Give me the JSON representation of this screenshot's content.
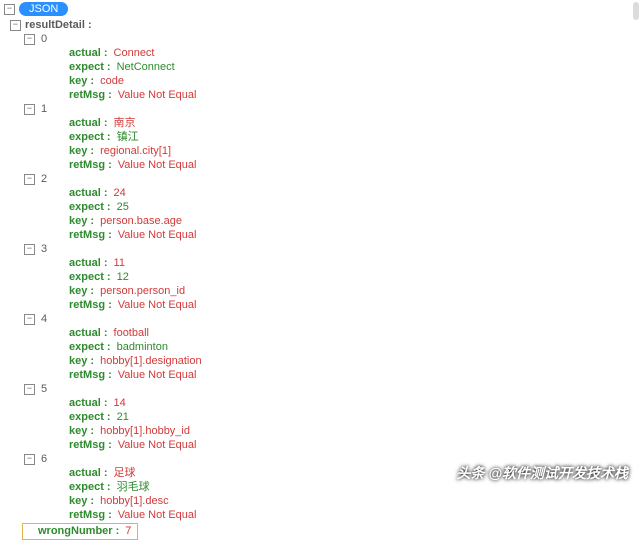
{
  "root": {
    "badge": "JSON"
  },
  "topKey": "resultDetail :",
  "toggle": {
    "plus": "+",
    "minus": "−"
  },
  "labels": {
    "actual": "actual :",
    "expect": "expect :",
    "key": "key :",
    "retMsg": "retMsg :"
  },
  "items": [
    {
      "idx": "0",
      "actual": "Connect",
      "expect": "NetConnect",
      "key": "code",
      "retMsg": "Value Not Equal"
    },
    {
      "idx": "1",
      "actual": "南京",
      "expect": "镇江",
      "key": "regional.city[1]",
      "retMsg": "Value Not Equal"
    },
    {
      "idx": "2",
      "actual": "24",
      "expect": "25",
      "key": "person.base.age",
      "retMsg": "Value Not Equal"
    },
    {
      "idx": "3",
      "actual": "11",
      "expect": "12",
      "key": "person.person_id",
      "retMsg": "Value Not Equal"
    },
    {
      "idx": "4",
      "actual": "football",
      "expect": "badminton",
      "key": "hobby[1].designation",
      "retMsg": "Value Not Equal"
    },
    {
      "idx": "5",
      "actual": "14",
      "expect": "21",
      "key": "hobby[1].hobby_id",
      "retMsg": "Value Not Equal"
    },
    {
      "idx": "6",
      "actual": "足球",
      "expect": "羽毛球",
      "key": "hobby[1].desc",
      "retMsg": "Value Not Equal"
    }
  ],
  "wrong": {
    "label": "wrongNumber :",
    "value": "7"
  },
  "watermark": "头条 @软件测试开发技术栈"
}
